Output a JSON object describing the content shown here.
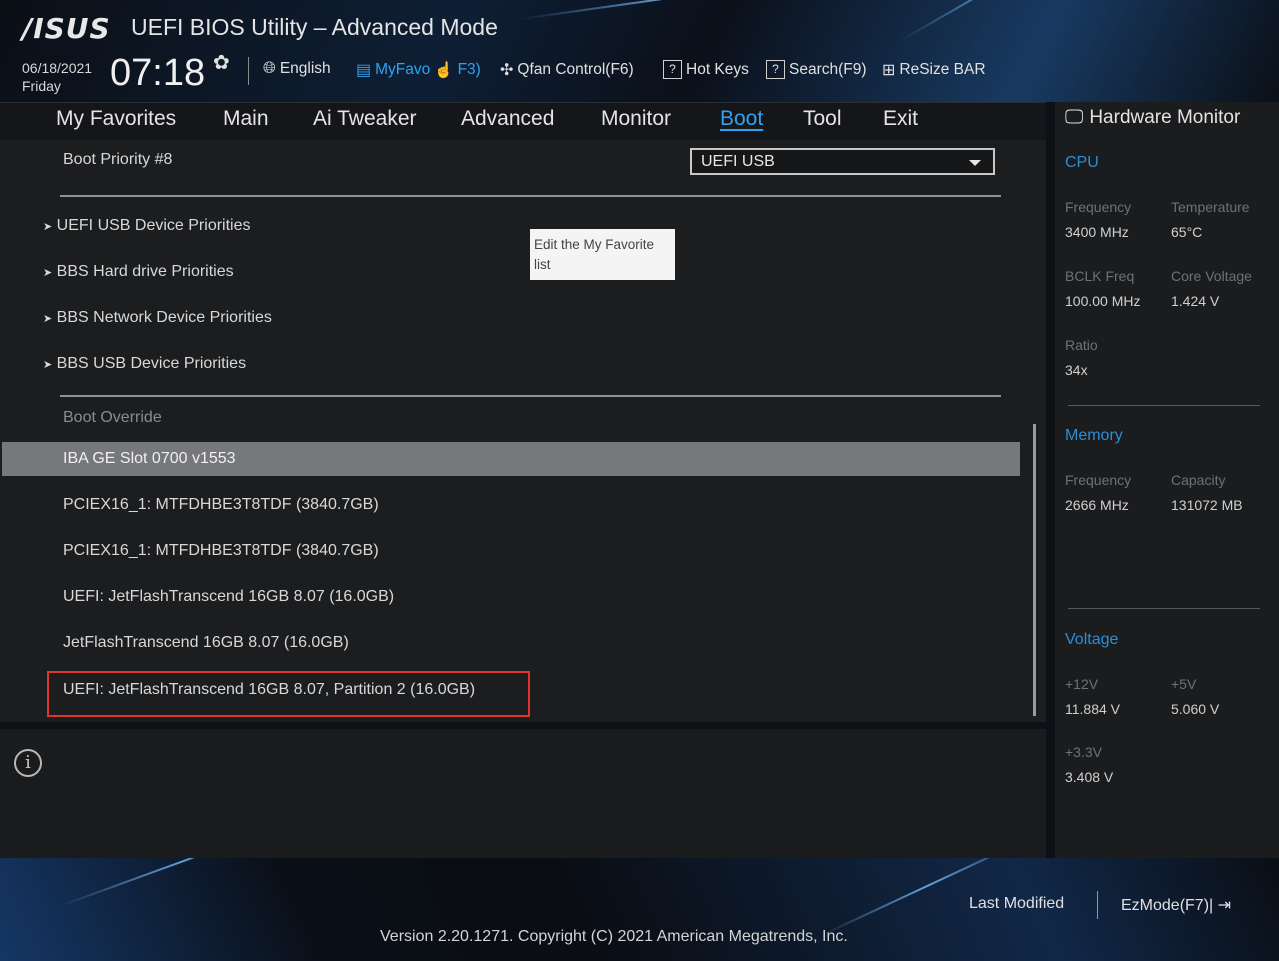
{
  "header": {
    "logo": "/ISUS",
    "title": "UEFI BIOS Utility – Advanced Mode",
    "date": "06/18/2021",
    "day": "Friday",
    "time": "07:18"
  },
  "toolbar": {
    "language": "English",
    "myfavorite": "MyFavo",
    "myfavorite_key": "F3)",
    "qfan": "Qfan Control(F6)",
    "hotkeys": "Hot Keys",
    "search": "Search(F9)",
    "resize_bar": "ReSize BAR"
  },
  "tabs": [
    {
      "label": "My Favorites"
    },
    {
      "label": "Main"
    },
    {
      "label": "Ai Tweaker"
    },
    {
      "label": "Advanced"
    },
    {
      "label": "Monitor"
    },
    {
      "label": "Boot",
      "active": true
    },
    {
      "label": "Tool"
    },
    {
      "label": "Exit"
    }
  ],
  "boot": {
    "priority_label": "Boot Priority #8",
    "priority_value": "UEFI USB",
    "submenus": [
      "UEFI USB Device Priorities",
      "BBS Hard drive Priorities",
      "BBS Network Device Priorities",
      "BBS USB Device Priorities"
    ],
    "override_header": "Boot Override",
    "override_items": [
      "IBA GE Slot 0700 v1553",
      "PCIEX16_1: MTFDHBE3T8TDF (3840.7GB)",
      "PCIEX16_1: MTFDHBE3T8TDF (3840.7GB)",
      "UEFI: JetFlashTranscend 16GB 8.07 (16.0GB)",
      "JetFlashTranscend 16GB 8.07 (16.0GB)",
      "UEFI: JetFlashTranscend 16GB 8.07, Partition 2 (16.0GB)"
    ],
    "tooltip": "Edit the My Favorite list"
  },
  "hardware_monitor": {
    "title": "Hardware Monitor",
    "cpu": {
      "heading": "CPU",
      "frequency_label": "Frequency",
      "frequency": "3400 MHz",
      "temperature_label": "Temperature",
      "temperature": "65°C",
      "bclk_label": "BCLK Freq",
      "bclk": "100.00 MHz",
      "core_voltage_label": "Core Voltage",
      "core_voltage": "1.424 V",
      "ratio_label": "Ratio",
      "ratio": "34x"
    },
    "memory": {
      "heading": "Memory",
      "frequency_label": "Frequency",
      "frequency": "2666 MHz",
      "capacity_label": "Capacity",
      "capacity": "131072 MB"
    },
    "voltage": {
      "heading": "Voltage",
      "v12_label": "+12V",
      "v12": "11.884 V",
      "v5_label": "+5V",
      "v5": "5.060 V",
      "v33_label": "+3.3V",
      "v33": "3.408 V"
    }
  },
  "footer": {
    "last_modified": "Last Modified",
    "ezmode": "EzMode(F7)|",
    "version": "Version 2.20.1271. Copyright (C) 2021 American Megatrends, Inc."
  },
  "colors": {
    "accent": "#2fa2f0",
    "highlight_box": "#e0342e",
    "selected_row": "#76787b"
  }
}
